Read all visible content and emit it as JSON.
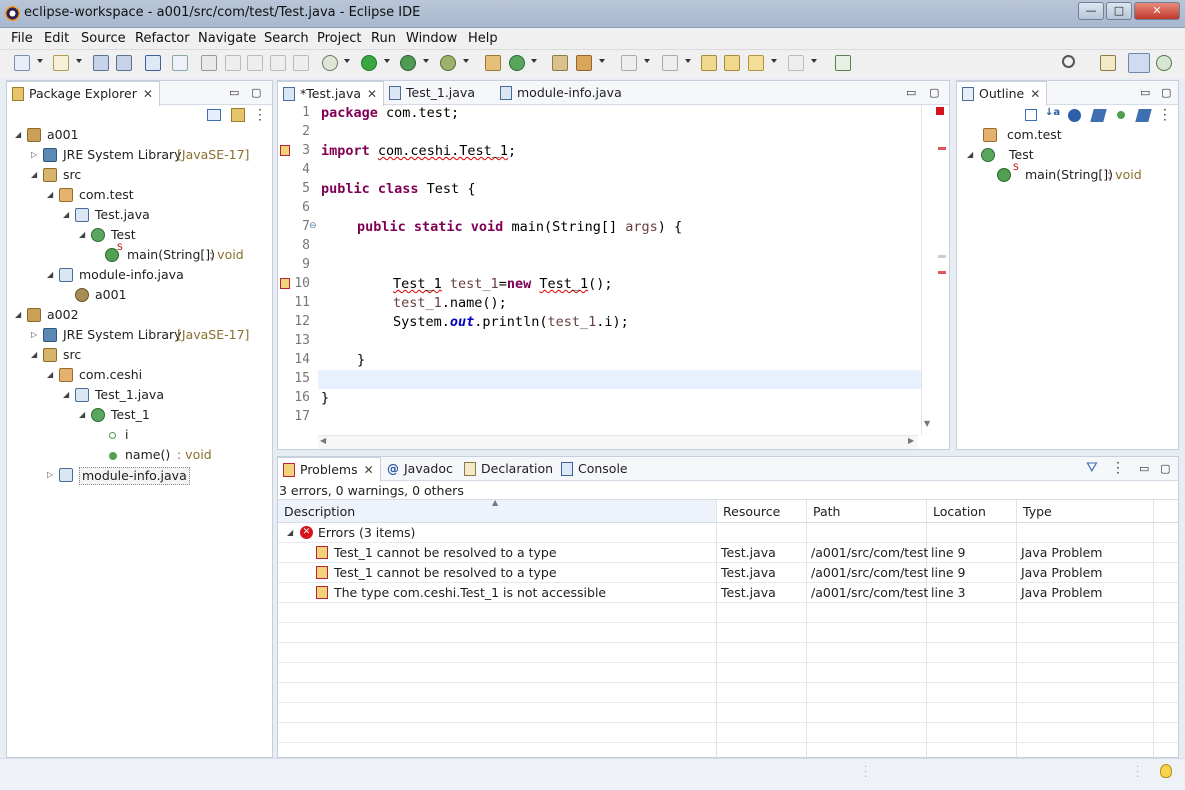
{
  "window": {
    "title": "eclipse-workspace - a001/src/com/test/Test.java - Eclipse IDE",
    "controls": {
      "minimize": "—",
      "maximize": "□",
      "close": "✕"
    }
  },
  "menu": [
    "File",
    "Edit",
    "Source",
    "Refactor",
    "Navigate",
    "Search",
    "Project",
    "Run",
    "Window",
    "Help"
  ],
  "package_explorer": {
    "title": "Package Explorer",
    "rows": [
      {
        "label": "a001",
        "decor": ""
      },
      {
        "label": "JRE System Library",
        "decor": "[JavaSE-17]"
      },
      {
        "label": "src",
        "decor": ""
      },
      {
        "label": "com.test",
        "decor": ""
      },
      {
        "label": "Test.java",
        "decor": ""
      },
      {
        "label": "Test",
        "decor": ""
      },
      {
        "label": "main(String[])",
        "decor": ": void",
        "modifier": "S"
      },
      {
        "label": "module-info.java",
        "decor": ""
      },
      {
        "label": "a001",
        "decor": ""
      },
      {
        "label": "a002",
        "decor": ""
      },
      {
        "label": "JRE System Library",
        "decor": "[JavaSE-17]"
      },
      {
        "label": "src",
        "decor": ""
      },
      {
        "label": "com.ceshi",
        "decor": ""
      },
      {
        "label": "Test_1.java",
        "decor": ""
      },
      {
        "label": "Test_1",
        "decor": ""
      },
      {
        "label": "i",
        "decor": ""
      },
      {
        "label": "name()",
        "decor": ": void"
      },
      {
        "label": "module-info.java",
        "decor": ""
      }
    ]
  },
  "editor": {
    "tabs": [
      "*Test.java",
      "Test_1.java",
      "module-info.java"
    ],
    "line_numbers": [
      "1",
      "2",
      "3",
      "4",
      "5",
      "6",
      "7",
      "8",
      "9",
      "10",
      "11",
      "12",
      "13",
      "14",
      "15",
      "16",
      "17"
    ],
    "code": {
      "l1_kw": "package",
      "l1_rest": " com.test;",
      "l3_kw": "import",
      "l3_err": "com.ceshi.Test_1",
      "l3_end": ";",
      "l5_kw": "public class",
      "l5_rest": " Test {",
      "l7_kw": "public static void",
      "l7_a": " main(String[] ",
      "l7_var": "args",
      "l7_b": ") {",
      "l10_err1": "Test_1",
      "l10_sp": " ",
      "l10_var": "test_1",
      "l10_eq": "=",
      "l10_kw": "new",
      "l10_sp2": " ",
      "l10_err2": "Test_1",
      "l10_end": "();",
      "l11_var": "test_1",
      "l11_rest": ".name();",
      "l12_a": "System.",
      "l12_fld": "out",
      "l12_b": ".println(",
      "l12_var": "test_1",
      "l12_c": ".i);",
      "l14": "}",
      "l16": "}"
    }
  },
  "outline": {
    "title": "Outline",
    "rows": [
      {
        "label": "com.test",
        "decor": ""
      },
      {
        "label": "Test",
        "decor": ""
      },
      {
        "label": "main(String[])",
        "decor": ": void",
        "modifier": "S"
      }
    ]
  },
  "problems": {
    "tabs": [
      "Problems",
      "Javadoc",
      "Declaration",
      "Console"
    ],
    "summary": "3 errors, 0 warnings, 0 others",
    "columns": [
      "Description",
      "Resource",
      "Path",
      "Location",
      "Type"
    ],
    "group": "Errors (3 items)",
    "rows": [
      {
        "description": "Test_1 cannot be resolved to a type",
        "resource": "Test.java",
        "path": "/a001/src/com/test",
        "location": "line 9",
        "type": "Java Problem"
      },
      {
        "description": "Test_1 cannot be resolved to a type",
        "resource": "Test.java",
        "path": "/a001/src/com/test",
        "location": "line 9",
        "type": "Java Problem"
      },
      {
        "description": "The type com.ceshi.Test_1 is not accessible",
        "resource": "Test.java",
        "path": "/a001/src/com/test",
        "location": "line 3",
        "type": "Java Problem"
      }
    ]
  },
  "colors": {
    "keyword": "#7f0055",
    "field": "#0000c0",
    "error": "#e00000",
    "selection": "#e8f2fe",
    "accent": "#3d7ac6"
  }
}
